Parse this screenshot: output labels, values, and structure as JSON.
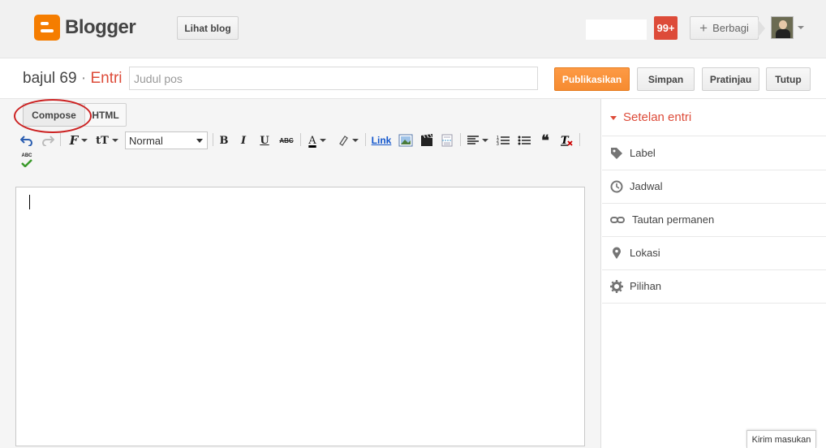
{
  "app": {
    "name": "Blogger"
  },
  "header": {
    "view_blog_label": "Lihat blog",
    "notifications_count": "99+",
    "share_label": "Berbagi",
    "share_plus": "+"
  },
  "post": {
    "blog_name": "bajul 69",
    "separator": "·",
    "crumb": "Entri",
    "title_placeholder": "Judul pos",
    "title_value": "",
    "publish_label": "Publikasikan",
    "save_label": "Simpan",
    "preview_label": "Pratinjau",
    "close_label": "Tutup"
  },
  "editor": {
    "mode_compose": "Compose",
    "mode_html": "HTML",
    "format_selected": "Normal",
    "link_label": "Link",
    "bold": "B",
    "italic": "I",
    "underline": "U",
    "strike": "ABC",
    "font_color": "A",
    "spellcheck": "ABC"
  },
  "sidebar": {
    "heading": "Setelan entri",
    "items": [
      {
        "label": "Label",
        "icon": "tag-icon"
      },
      {
        "label": "Jadwal",
        "icon": "clock-icon"
      },
      {
        "label": "Tautan permanen",
        "icon": "link-icon"
      },
      {
        "label": "Lokasi",
        "icon": "map-pin-icon"
      },
      {
        "label": "Pilihan",
        "icon": "gear-icon"
      }
    ]
  },
  "footer": {
    "feedback_label": "Kirim masukan"
  },
  "colors": {
    "accent": "#dd4b39",
    "publish": "#f68b30",
    "brand": "#f57d00"
  }
}
